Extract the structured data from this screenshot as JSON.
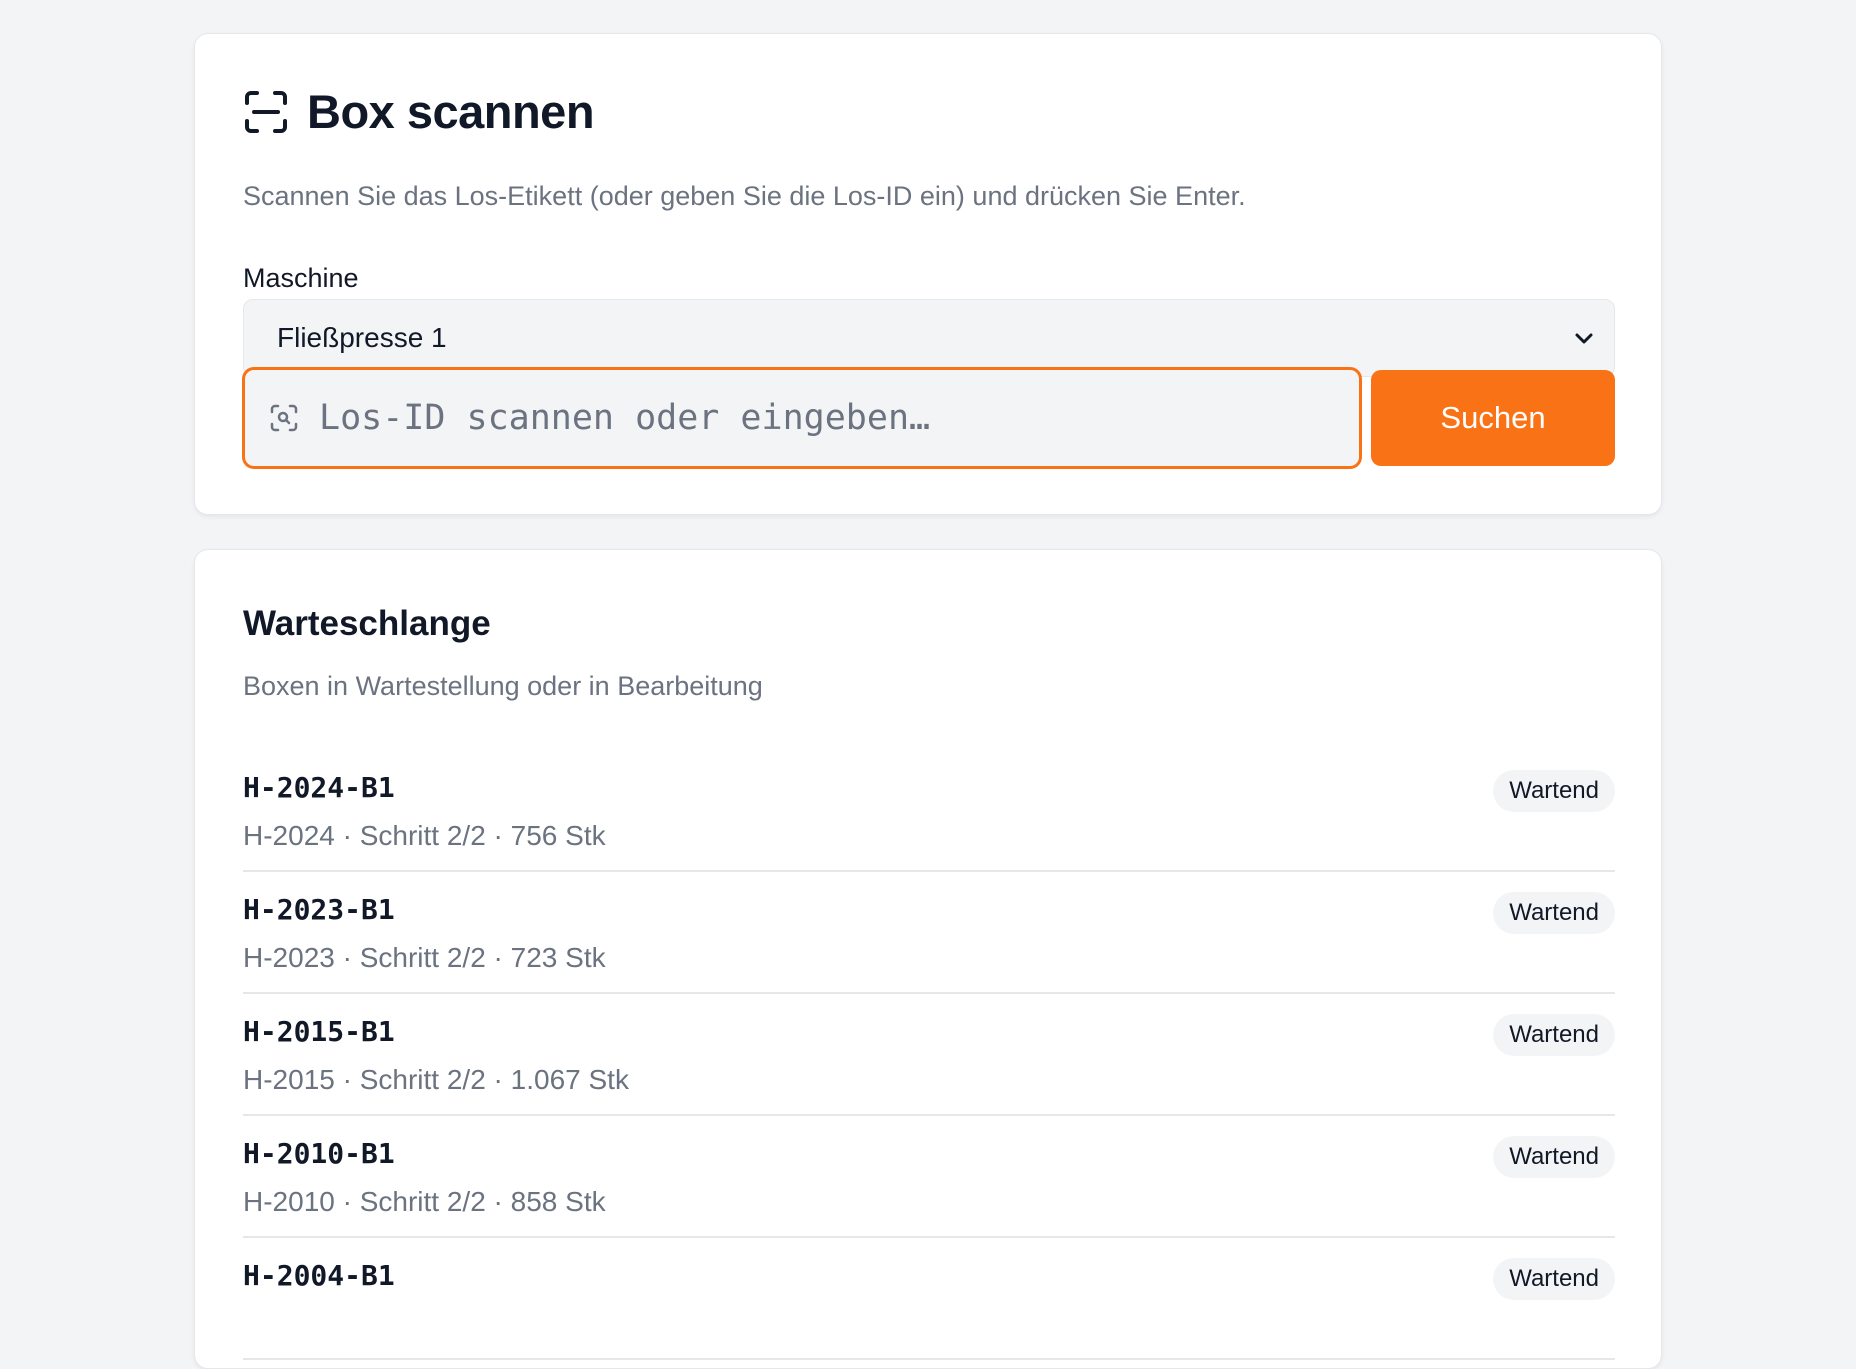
{
  "scan": {
    "title": "Box scannen",
    "icon": "scan-frame-icon",
    "subtitle": "Scannen Sie das Los-Etikett (oder geben Sie die Los-ID ein) und drücken Sie Enter.",
    "machine_label": "Maschine",
    "machine_selected": "Fließpresse 1",
    "input_placeholder": "Los-ID scannen oder eingeben…",
    "search_button": "Suchen"
  },
  "queue": {
    "title": "Warteschlange",
    "subtitle": "Boxen in Wartestellung oder in Bearbeitung",
    "items": [
      {
        "id": "H-2024-B1",
        "meta": "H-2024 · Schritt 2/2 · 756 Stk",
        "status": "Wartend"
      },
      {
        "id": "H-2023-B1",
        "meta": "H-2023 · Schritt 2/2 · 723 Stk",
        "status": "Wartend"
      },
      {
        "id": "H-2015-B1",
        "meta": "H-2015 · Schritt 2/2 · 1.067 Stk",
        "status": "Wartend"
      },
      {
        "id": "H-2010-B1",
        "meta": "H-2010 · Schritt 2/2 · 858 Stk",
        "status": "Wartend"
      },
      {
        "id": "H-2004-B1",
        "meta": "",
        "status": "Wartend"
      }
    ]
  },
  "colors": {
    "accent": "#f97316",
    "background": "#f3f4f6",
    "muted_text": "#6b7280"
  }
}
